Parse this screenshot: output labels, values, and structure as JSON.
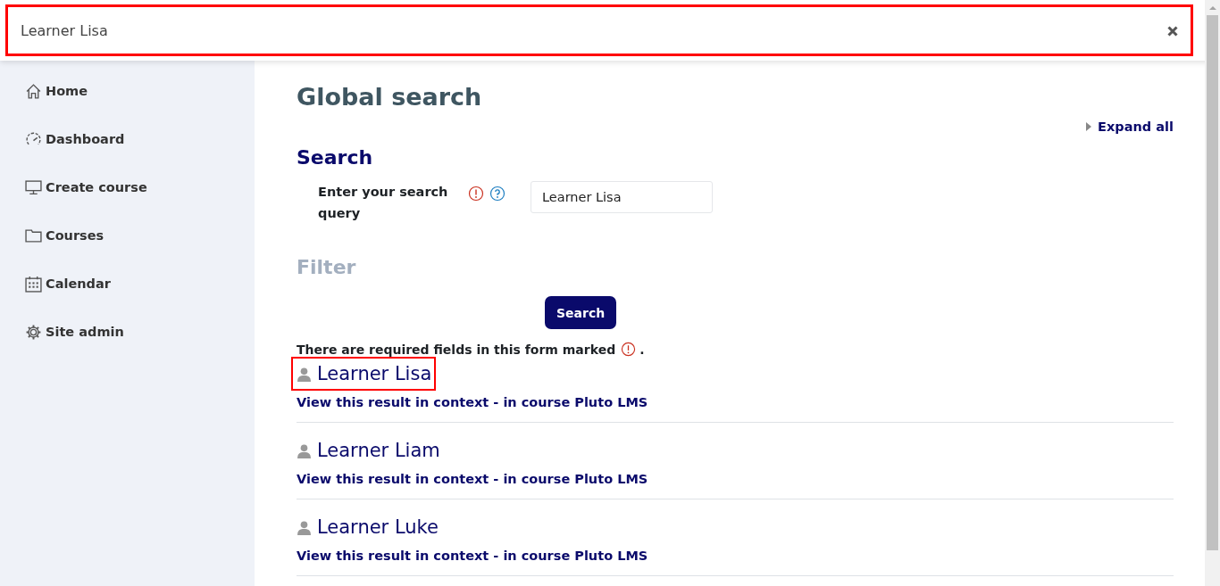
{
  "search_bar": {
    "value": "Learner Lisa",
    "highlighted": true
  },
  "sidebar": {
    "items": [
      {
        "label": "Home"
      },
      {
        "label": "Dashboard"
      },
      {
        "label": "Create course"
      },
      {
        "label": "Courses"
      },
      {
        "label": "Calendar"
      },
      {
        "label": "Site admin"
      }
    ]
  },
  "page": {
    "title": "Global search",
    "expand_all": "Expand all",
    "search_section": {
      "title": "Search",
      "label": "Enter your search query",
      "value": "Learner Lisa",
      "required": true
    },
    "filter_section": {
      "title": "Filter",
      "disabled": true
    },
    "button": "Search",
    "required_note": {
      "text": "There are required fields in this form marked",
      "tail": "."
    },
    "results": [
      {
        "title": "Learner Lisa",
        "link": "View this result in context - in course Pluto LMS",
        "highlighted": true
      },
      {
        "title": "Learner Liam",
        "link": "View this result in context - in course Pluto LMS",
        "highlighted": false
      },
      {
        "title": "Learner Luke",
        "link": "View this result in context - in course Pluto LMS",
        "highlighted": false
      }
    ]
  }
}
